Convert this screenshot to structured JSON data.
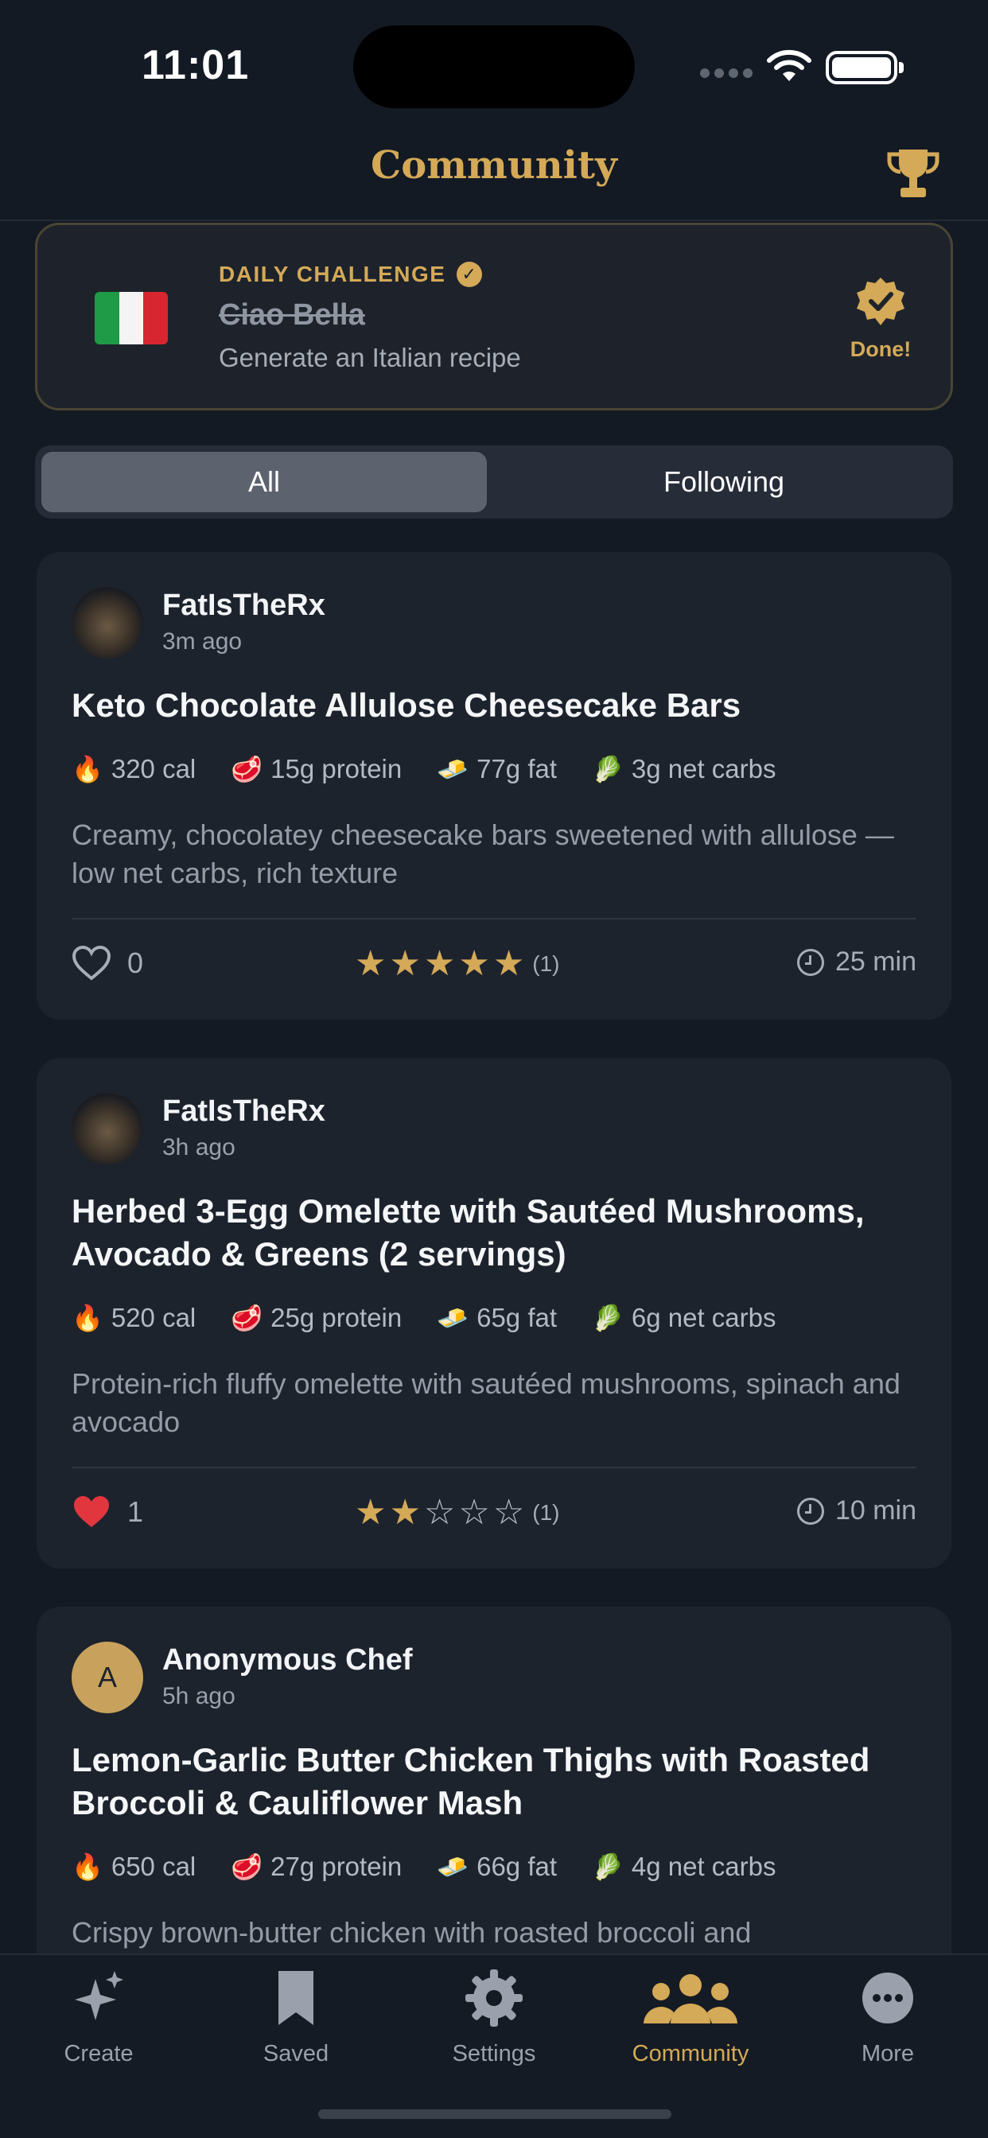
{
  "status_bar": {
    "time": "11:01"
  },
  "header": {
    "title": "Community",
    "trophy_icon": "trophy-icon",
    "accent_color": "#d4a957"
  },
  "challenge": {
    "label": "DAILY CHALLENGE",
    "title": "Ciao Bella",
    "subtitle": "Generate an Italian recipe",
    "status": "Done!",
    "icon": "italy-flag-icon"
  },
  "segment": {
    "options": [
      "All",
      "Following"
    ],
    "selected": "All"
  },
  "posts": [
    {
      "author": "FatIsTheRx",
      "time_ago": "3m ago",
      "title": "Keto Chocolate Allulose Cheesecake Bars",
      "macros": {
        "cal": "320 cal",
        "protein": "15g protein",
        "fat": "77g fat",
        "carbs": "3g net carbs"
      },
      "description": "Creamy, chocolatey cheesecake bars sweetened with allulose — low net carbs, rich texture",
      "likes": "0",
      "liked": false,
      "rating": 5,
      "rating_count": "(1)",
      "duration": "25 min"
    },
    {
      "author": "FatIsTheRx",
      "time_ago": "3h ago",
      "title": "Herbed 3-Egg Omelette with Sautéed Mushrooms, Avocado & Greens (2 servings)",
      "macros": {
        "cal": "520 cal",
        "protein": "25g protein",
        "fat": "65g fat",
        "carbs": "6g net carbs"
      },
      "description": "Protein-rich fluffy omelette with sautéed mushrooms, spinach and avocado",
      "likes": "1",
      "liked": true,
      "rating": 2,
      "rating_count": "(1)",
      "duration": "10 min"
    },
    {
      "author": "Anonymous Chef",
      "avatar_letter": "A",
      "time_ago": "5h ago",
      "title": "Lemon-Garlic Butter Chicken Thighs with Roasted Broccoli & Cauliflower Mash",
      "macros": {
        "cal": "650 cal",
        "protein": "27g protein",
        "fat": "66g fat",
        "carbs": "4g net carbs"
      },
      "description": "Crispy brown-butter chicken with roasted broccoli and"
    }
  ],
  "tabbar": {
    "tabs": [
      {
        "label": "Create",
        "icon": "sparkles-icon"
      },
      {
        "label": "Saved",
        "icon": "bookmark-icon"
      },
      {
        "label": "Settings",
        "icon": "gear-icon"
      },
      {
        "label": "Community",
        "icon": "people-icon"
      },
      {
        "label": "More",
        "icon": "more-icon"
      }
    ],
    "active": "Community"
  }
}
